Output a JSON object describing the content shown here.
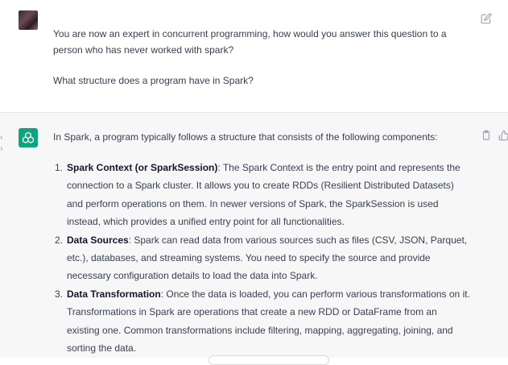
{
  "user_message": {
    "question": "You are now an expert in concurrent programming, how would you answer this question to a person who has never worked with spark?",
    "followup": "What structure does a program have in Spark?"
  },
  "assistant_message": {
    "intro": "In Spark, a program typically follows a structure that consists of the following components:",
    "items": [
      {
        "number": "1.",
        "term": "Spark Context (or SparkSession)",
        "text": ": The Spark Context is the entry point and represents the connection to a Spark cluster. It allows you to create RDDs (Resilient Distributed Datasets) and perform operations on them. In newer versions of Spark, the SparkSession is used instead, which provides a unified entry point for all functionalities."
      },
      {
        "number": "2.",
        "term": "Data Sources",
        "text": ": Spark can read data from various sources such as files (CSV, JSON, Parquet, etc.), databases, and streaming systems. You need to specify the source and provide necessary configuration details to load the data into Spark."
      },
      {
        "number": "3.",
        "term": "Data Transformation",
        "text": ": Once the data is loaded, you can perform various transformations on it. Transformations in Spark are operations that create a new RDD or DataFrame from an existing one. Common transformations include filtering, mapping, aggregating, joining, and sorting the data."
      }
    ]
  },
  "icons": {
    "user_avatar": "user-avatar",
    "assistant_avatar": "chatgpt-logo-icon",
    "edit": "edit-icon",
    "copy": "clipboard-icon",
    "like": "thumbs-up-icon",
    "previous": "chevron-left-icon"
  },
  "colors": {
    "assistant_avatar_bg": "#10a37f",
    "assistant_bg": "#f7f7f8",
    "text": "#374151"
  }
}
